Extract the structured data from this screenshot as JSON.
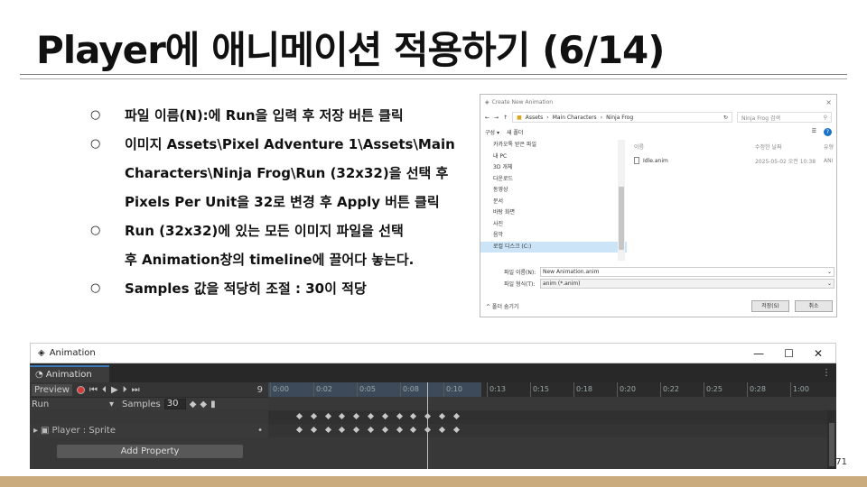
{
  "slide": {
    "title": "Player에 애니메이션 적용하기 (6/14)",
    "page_number": "71",
    "bullets": [
      {
        "mark": "○",
        "lines": [
          "파일 이름(N):에 Run을 입력 후 저장 버튼 클릭"
        ]
      },
      {
        "mark": "○",
        "lines": [
          "이미지 Assets\\Pixel Adventure 1\\Assets\\Main",
          "Characters\\Ninja Frog\\Run (32x32)을 선택 후",
          "Pixels Per Unit을 32로 변경 후 Apply 버튼 클릭"
        ]
      },
      {
        "mark": "○",
        "lines": [
          "Run (32x32)에 있는 모든 이미지 파일을 선택",
          "후 Animation창의 timeline에 끌어다 놓는다."
        ]
      },
      {
        "mark": "○",
        "lines": [
          "Samples 값을 적당히 조절 : 30이 적당"
        ]
      }
    ]
  },
  "dialog": {
    "title": "Create New Animation",
    "close": "×",
    "breadcrumb": [
      "Assets",
      "Main Characters",
      "Ninja Frog"
    ],
    "search_placeholder": "Ninja Frog 검색",
    "organize": "구성 ▾",
    "new_folder": "새 폴더",
    "tree": [
      "카카오톡 받은 파일",
      "내 PC",
      "3D 개체",
      "다운로드",
      "동영상",
      "문서",
      "바탕 화면",
      "사진",
      "음악",
      "로컬 디스크 (C:)"
    ],
    "columns": [
      "이름",
      "수정한 날짜",
      "유형"
    ],
    "files": [
      {
        "name": "Idle.anim",
        "date": "2025-05-02 오전 10:38",
        "type": "ANI"
      }
    ],
    "filename_label": "파일 이름(N):",
    "filename_value": "New Animation.anim",
    "filetype_label": "파일 형식(T):",
    "filetype_value": "anim (*.anim)",
    "hide_folders": "^ 폴더 숨기기",
    "save_label": "저장(S)",
    "cancel_label": "취소"
  },
  "animation_window": {
    "window_title": "Animation",
    "tab_label": "Animation",
    "preview_label": "Preview",
    "frame": "9",
    "clip_name": "Run",
    "samples_label": "Samples",
    "samples_value": "30",
    "property_label": "Player : Sprite",
    "add_property_label": "Add Property",
    "ruler_ticks": [
      "0:00",
      "0:02",
      "0:05",
      "0:08",
      "0:10",
      "0:13",
      "0:15",
      "0:18",
      "0:20",
      "0:22",
      "0:25",
      "0:28",
      "1:00"
    ],
    "keyframe_count": 12
  }
}
